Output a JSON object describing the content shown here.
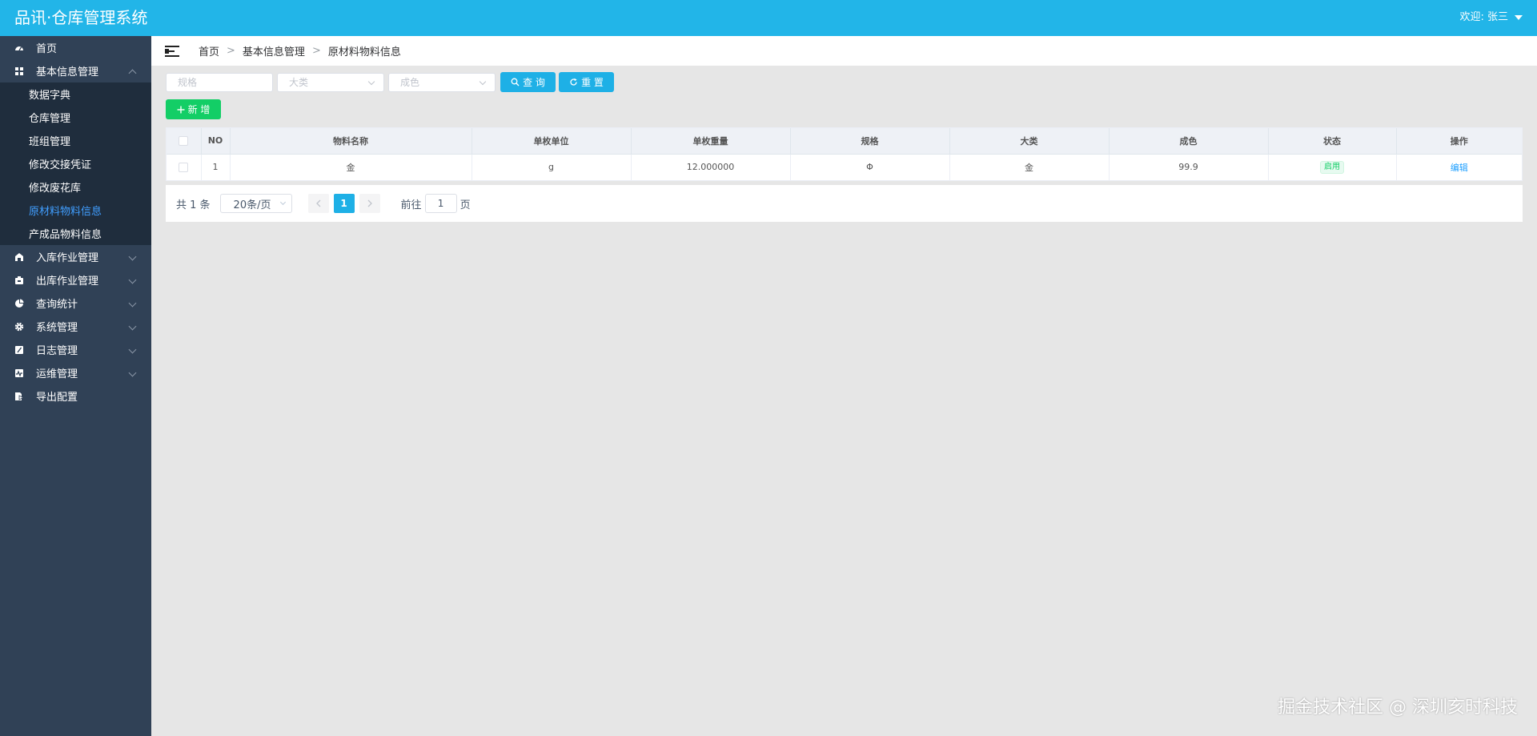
{
  "header": {
    "app_title": "品讯·仓库管理系统",
    "welcome": "欢迎: 张三"
  },
  "sidebar": {
    "items": [
      {
        "label": "首页",
        "icon": "dashboard-icon"
      },
      {
        "label": "基本信息管理",
        "icon": "grid-icon",
        "expanded": true
      },
      {
        "label": "入库作业管理",
        "icon": "inbound-icon"
      },
      {
        "label": "出库作业管理",
        "icon": "outbound-icon"
      },
      {
        "label": "查询统计",
        "icon": "pie-chart-icon"
      },
      {
        "label": "系统管理",
        "icon": "gear-icon"
      },
      {
        "label": "日志管理",
        "icon": "log-icon"
      },
      {
        "label": "运维管理",
        "icon": "monitor-icon"
      },
      {
        "label": "导出配置",
        "icon": "export-icon"
      }
    ],
    "sub_items": [
      {
        "label": "数据字典"
      },
      {
        "label": "仓库管理"
      },
      {
        "label": "班组管理"
      },
      {
        "label": "修改交接凭证"
      },
      {
        "label": "修改废花库"
      },
      {
        "label": "原材料物料信息",
        "active": true
      },
      {
        "label": "产成品物料信息"
      }
    ]
  },
  "breadcrumb": {
    "home": "首页",
    "separator": ">",
    "level1": "基本信息管理",
    "level2": "原材料物料信息"
  },
  "filters": {
    "spec_placeholder": "规格",
    "category_placeholder": "大类",
    "purity_placeholder": "成色",
    "query_label": "查 询",
    "reset_label": "重 置"
  },
  "toolbar": {
    "add_label": "新 增"
  },
  "table": {
    "headers": [
      "NO",
      "物料名称",
      "单枚单位",
      "单枚重量",
      "规格",
      "大类",
      "成色",
      "状态",
      "操作"
    ],
    "rows": [
      {
        "no": "1",
        "name": "金",
        "unit": "g",
        "weight": "12.000000",
        "spec": "Φ",
        "category": "金",
        "purity": "99.9",
        "status": "启用",
        "action": "编辑"
      }
    ]
  },
  "pagination": {
    "total": "共 1 条",
    "page_size": "20条/页",
    "current_page": "1",
    "goto_prefix": "前往",
    "goto_value": "1",
    "goto_suffix": "页"
  },
  "watermark": "掘金技术社区 @ 深圳亥时科技",
  "colors": {
    "header": "#22b5e8",
    "sidebar": "#304156",
    "submenu": "#1f2d3d",
    "active_link": "#409eff",
    "primary_button": "#1eb0e6",
    "success_button": "#13ce66"
  }
}
